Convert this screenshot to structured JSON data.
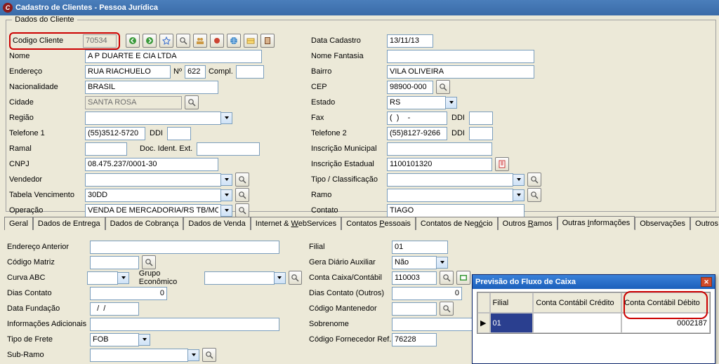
{
  "window": {
    "title": "Cadastro de Clientes - Pessoa Jurídica"
  },
  "groupbox": {
    "legend": "Dados do Cliente"
  },
  "left": {
    "codigo_label": "Codigo Cliente",
    "codigo_value": "70534",
    "nome_label": "Nome",
    "nome_value": "A P DUARTE E CIA LTDA",
    "endereco_label": "Endereço",
    "endereco_value": "RUA RIACHUELO",
    "num_label": "Nº",
    "num_value": "622",
    "compl_label": "Compl.",
    "compl_value": "",
    "nacionalidade_label": "Nacionalidade",
    "nacionalidade_value": "BRASIL",
    "cidade_label": "Cidade",
    "cidade_value": "SANTA ROSA",
    "regiao_label": "Região",
    "regiao_value": "",
    "telefone1_label": "Telefone 1",
    "telefone1_value": "(55)3512-5720",
    "ddi1_label": "DDI",
    "ddi1_value": "",
    "ramal_label": "Ramal",
    "ramal_value": "",
    "doc_ident_label": "Doc. Ident. Ext.",
    "doc_ident_value": "",
    "cnpj_label": "CNPJ",
    "cnpj_value": "08.475.237/0001-30",
    "vendedor_label": "Vendedor",
    "vendedor_value": "",
    "tabela_label": "Tabela Vencimento",
    "tabela_value": "30DD",
    "operacao_label": "Operação",
    "operacao_value": "VENDA DE MERCADORIA/RS TB/MONO"
  },
  "right": {
    "data_cadastro_label": "Data Cadastro",
    "data_cadastro_value": "13/11/13",
    "nome_fantasia_label": "Nome Fantasia",
    "nome_fantasia_value": "",
    "bairro_label": "Bairro",
    "bairro_value": "VILA OLIVEIRA",
    "cep_label": "CEP",
    "cep_value": "98900-000",
    "estado_label": "Estado",
    "estado_value": "RS",
    "fax_label": "Fax",
    "fax_value": "(  )    -",
    "fax_ddi_label": "DDI",
    "fax_ddi_value": "",
    "telefone2_label": "Telefone 2",
    "telefone2_value": "(55)8127-9266",
    "ddi2_label": "DDI",
    "ddi2_value": "",
    "insc_mun_label": "Inscrição Municipal",
    "insc_mun_value": "",
    "insc_est_label": "Inscrição Estadual",
    "insc_est_value": "1100101320",
    "tipo_label": "Tipo / Classificação",
    "tipo_value": "",
    "ramo_label": "Ramo",
    "ramo_value": "",
    "contato_label": "Contato",
    "contato_value": "TIAGO"
  },
  "tabs": {
    "geral": "Geral",
    "entrega": "Dados de Entrega",
    "cobranca": "Dados de Cobrança",
    "venda": "Dados de Venda",
    "internet_prefix": "Internet & ",
    "internet_under": "W",
    "internet_suffix": "ebServices",
    "pessoais_prefix": "Contatos ",
    "pessoais_under": "P",
    "pessoais_suffix": "essoais",
    "negocio_prefix": "Contatos de Neg",
    "negocio_under": "ó",
    "negocio_suffix": "cio",
    "ramos_prefix": "Outros ",
    "ramos_under": "R",
    "ramos_suffix": "amos",
    "outras_prefix": "Outras ",
    "outras_under": "I",
    "outras_suffix": "nformações",
    "obs": "Observações",
    "outros_contatos": "Outros Contatos de Negócio"
  },
  "tabpage": {
    "end_anterior_label": "Endereço Anterior",
    "end_anterior_value": "",
    "cod_matriz_label": "Código Matriz",
    "cod_matriz_value": "",
    "curva_label": "Curva ABC",
    "curva_value": "",
    "grupo_label": "Grupo Econômico",
    "grupo_value": "",
    "dias_contato_label": "Dias Contato",
    "dias_contato_value": "0",
    "data_fund_label": "Data Fundação",
    "data_fund_value": "  /  /",
    "info_adic_label": "Informações Adicionais",
    "info_adic_value": "",
    "tipo_frete_label": "Tipo de Frete",
    "tipo_frete_value": "FOB",
    "subramo_label": "Sub-Ramo",
    "subramo_value": "",
    "filial_label": "Filial",
    "filial_value": "01",
    "gera_diario_label": "Gera Diário Auxiliar",
    "gera_diario_value": "Não",
    "conta_caixa_label": "Conta Caixa/Contábil",
    "conta_caixa_value": "110003",
    "dias_outros_label": "Dias Contato (Outros)",
    "dias_outros_value": "0",
    "cod_mant_label": "Código Mantenedor",
    "cod_mant_value": "",
    "sobrenome_label": "Sobrenome",
    "sobrenome_value": "",
    "cod_forn_label": "Código Fornecedor Ref.",
    "cod_forn_value": "76228"
  },
  "popup": {
    "title": "Previsão do Fluxo de Caixa",
    "col_filial": "Filial",
    "col_credito": "Conta Contábil Crédito",
    "col_debito": "Conta Contábil Débito",
    "row1_filial": "01",
    "row1_credito": "",
    "row1_debito": "0002187"
  }
}
